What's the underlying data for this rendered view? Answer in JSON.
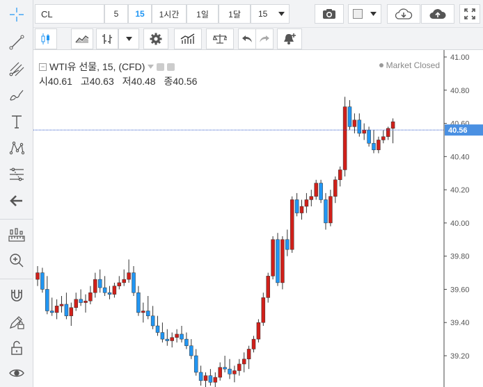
{
  "header": {
    "symbol": "CL",
    "intervals": [
      {
        "label": "5",
        "active": false
      },
      {
        "label": "15",
        "active": true
      },
      {
        "label": "1시간",
        "active": false
      },
      {
        "label": "1일",
        "active": false
      },
      {
        "label": "1달",
        "active": false
      }
    ],
    "interval_select": "15"
  },
  "legend": {
    "title": "WTI유 선물, 15, (CFD)",
    "open_label": "시",
    "open": "40.61",
    "high_label": "고",
    "high": "40.63",
    "low_label": "저",
    "low": "40.48",
    "close_label": "종",
    "close": "40.56",
    "market_status": "Market Closed"
  },
  "colors": {
    "up": "#2196f3",
    "down": "#d0201a",
    "wick": "#333333",
    "price_line": "#2a55c8",
    "accent": "#2196f3"
  },
  "chart_data": {
    "type": "candlestick",
    "y_ticks": [
      "41.00",
      "40.80",
      "40.60",
      "40.40",
      "40.20",
      "40.00",
      "39.80",
      "39.60",
      "39.40",
      "39.20"
    ],
    "ylim": [
      39.15,
      41.05
    ],
    "last_price": "40.56",
    "candles": [
      [
        39.66,
        39.74,
        39.62,
        39.7
      ],
      [
        39.7,
        39.73,
        39.58,
        39.6
      ],
      [
        39.6,
        39.68,
        39.45,
        39.47
      ],
      [
        39.47,
        39.55,
        39.44,
        39.46
      ],
      [
        39.46,
        39.54,
        39.42,
        39.5
      ],
      [
        39.5,
        39.56,
        39.46,
        39.51
      ],
      [
        39.51,
        39.58,
        39.42,
        39.44
      ],
      [
        39.44,
        39.52,
        39.38,
        39.49
      ],
      [
        39.49,
        39.58,
        39.47,
        39.54
      ],
      [
        39.54,
        39.6,
        39.5,
        39.52
      ],
      [
        39.52,
        39.57,
        39.46,
        39.53
      ],
      [
        39.53,
        39.62,
        39.51,
        39.58
      ],
      [
        39.58,
        39.7,
        39.55,
        39.66
      ],
      [
        39.66,
        39.72,
        39.58,
        39.61
      ],
      [
        39.61,
        39.68,
        39.56,
        39.58
      ],
      [
        39.58,
        39.62,
        39.54,
        39.57
      ],
      [
        39.57,
        39.64,
        39.55,
        39.62
      ],
      [
        39.62,
        39.68,
        39.6,
        39.64
      ],
      [
        39.64,
        39.72,
        39.62,
        39.66
      ],
      [
        39.66,
        39.78,
        39.64,
        39.7
      ],
      [
        39.7,
        39.74,
        39.56,
        39.58
      ],
      [
        39.58,
        39.62,
        39.44,
        39.46
      ],
      [
        39.46,
        39.52,
        39.4,
        39.47
      ],
      [
        39.47,
        39.56,
        39.42,
        39.44
      ],
      [
        39.44,
        39.5,
        39.36,
        39.38
      ],
      [
        39.38,
        39.44,
        39.32,
        39.34
      ],
      [
        39.34,
        39.4,
        39.28,
        39.3
      ],
      [
        39.3,
        39.36,
        39.26,
        39.29
      ],
      [
        39.29,
        39.34,
        39.25,
        39.31
      ],
      [
        39.31,
        39.36,
        39.28,
        39.33
      ],
      [
        39.33,
        39.38,
        39.28,
        39.3
      ],
      [
        39.3,
        39.34,
        39.24,
        39.26
      ],
      [
        39.26,
        39.3,
        39.18,
        39.2
      ],
      [
        39.2,
        39.24,
        39.08,
        39.1
      ],
      [
        39.1,
        39.14,
        39.02,
        39.05
      ],
      [
        39.05,
        39.1,
        39.0,
        39.08
      ],
      [
        39.08,
        39.12,
        39.02,
        39.04
      ],
      [
        39.04,
        39.1,
        39.0,
        39.07
      ],
      [
        39.07,
        39.16,
        39.05,
        39.13
      ],
      [
        39.13,
        39.2,
        39.1,
        39.12
      ],
      [
        39.12,
        39.18,
        39.06,
        39.09
      ],
      [
        39.09,
        39.14,
        39.04,
        39.11
      ],
      [
        39.11,
        39.18,
        39.08,
        39.15
      ],
      [
        39.15,
        39.22,
        39.1,
        39.18
      ],
      [
        39.18,
        39.26,
        39.12,
        39.24
      ],
      [
        39.24,
        39.32,
        39.22,
        39.3
      ],
      [
        39.3,
        39.42,
        39.28,
        39.4
      ],
      [
        39.4,
        39.58,
        39.38,
        39.55
      ],
      [
        39.55,
        39.7,
        39.52,
        39.68
      ],
      [
        39.68,
        39.92,
        39.66,
        39.9
      ],
      [
        39.9,
        39.94,
        39.62,
        39.64
      ],
      [
        39.64,
        39.92,
        39.6,
        39.9
      ],
      [
        39.9,
        39.96,
        39.8,
        39.84
      ],
      [
        39.84,
        40.16,
        39.82,
        40.14
      ],
      [
        40.14,
        40.18,
        40.04,
        40.06
      ],
      [
        40.06,
        40.14,
        40.02,
        40.1
      ],
      [
        40.1,
        40.18,
        40.06,
        40.14
      ],
      [
        40.14,
        40.2,
        40.1,
        40.16
      ],
      [
        40.16,
        40.26,
        40.14,
        40.24
      ],
      [
        40.24,
        40.26,
        40.12,
        40.14
      ],
      [
        40.14,
        40.18,
        39.96,
        40.0
      ],
      [
        40.0,
        40.2,
        39.98,
        40.16
      ],
      [
        40.16,
        40.28,
        40.12,
        40.26
      ],
      [
        40.26,
        40.34,
        40.22,
        40.32
      ],
      [
        40.32,
        40.76,
        40.28,
        40.7
      ],
      [
        40.7,
        40.74,
        40.56,
        40.58
      ],
      [
        40.58,
        40.66,
        40.54,
        40.62
      ],
      [
        40.62,
        40.66,
        40.52,
        40.54
      ],
      [
        40.54,
        40.6,
        40.5,
        40.56
      ],
      [
        40.56,
        40.58,
        40.46,
        40.48
      ],
      [
        40.48,
        40.56,
        40.42,
        40.44
      ],
      [
        40.44,
        40.52,
        40.42,
        40.5
      ],
      [
        40.5,
        40.56,
        40.48,
        40.52
      ],
      [
        40.52,
        40.58,
        40.5,
        40.57
      ],
      [
        40.57,
        40.63,
        40.48,
        40.61
      ]
    ]
  }
}
